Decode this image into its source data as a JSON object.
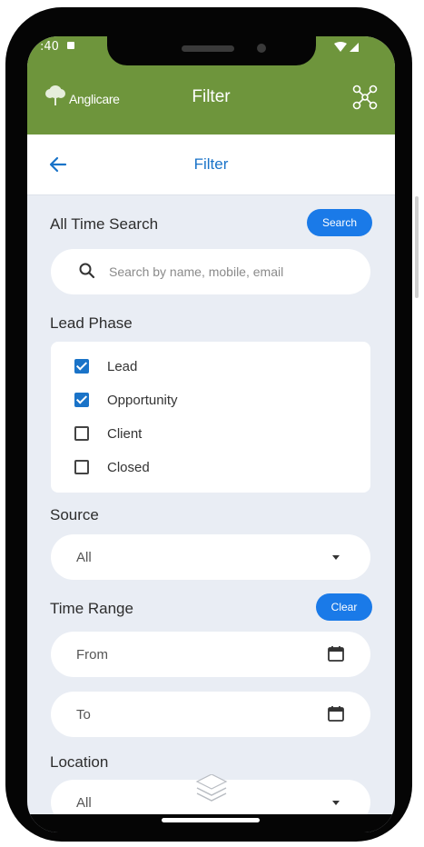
{
  "status_bar": {
    "time": ":40"
  },
  "header": {
    "logo_text": "Anglicare",
    "title": "Filter"
  },
  "subheader": {
    "title": "Filter"
  },
  "all_time_search": {
    "label": "All Time Search",
    "button_label": "Search",
    "placeholder": "Search by name, mobile, email"
  },
  "lead_phase": {
    "label": "Lead Phase",
    "options": [
      {
        "label": "Lead",
        "checked": true
      },
      {
        "label": "Opportunity",
        "checked": true
      },
      {
        "label": "Client",
        "checked": false
      },
      {
        "label": "Closed",
        "checked": false
      }
    ]
  },
  "source": {
    "label": "Source",
    "value": "All"
  },
  "time_range": {
    "label": "Time Range",
    "clear_label": "Clear",
    "from_label": "From",
    "to_label": "To"
  },
  "location": {
    "label": "Location",
    "value": "All"
  },
  "icons": [
    "network-icon",
    "back-arrow-icon",
    "search-icon",
    "calendar-icon",
    "layers-icon",
    "chevron-down-icon"
  ],
  "colors": {
    "header_green": "#6e953c",
    "accent_blue": "#1a7ae8",
    "background": "#e9edf4"
  }
}
